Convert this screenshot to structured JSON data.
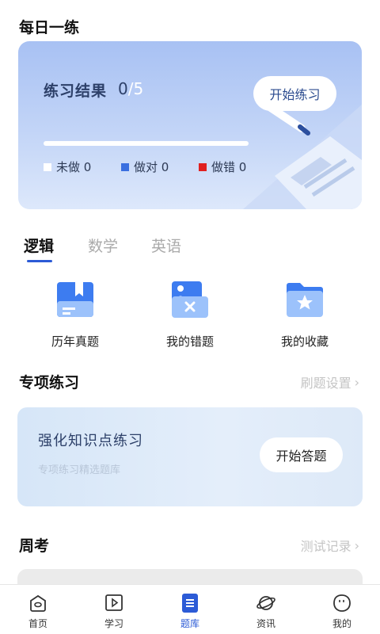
{
  "daily": {
    "title": "每日一练",
    "result_label": "练习结果",
    "done_count": "0",
    "separator": "/",
    "total_count": "5",
    "progress_fraction": 0,
    "start_label": "开始练习",
    "legend": [
      {
        "label": "未做",
        "count": "0",
        "color": "#ffffff"
      },
      {
        "label": "做对",
        "count": "0",
        "color": "#3a6fe0"
      },
      {
        "label": "做错",
        "count": "0",
        "color": "#e02020"
      }
    ]
  },
  "tabs": [
    {
      "label": "逻辑",
      "active": true
    },
    {
      "label": "数学",
      "active": false
    },
    {
      "label": "英语",
      "active": false
    }
  ],
  "features": [
    {
      "label": "历年真题",
      "icon": "book-icon"
    },
    {
      "label": "我的错题",
      "icon": "wrong-question-icon"
    },
    {
      "label": "我的收藏",
      "icon": "star-folder-icon"
    }
  ],
  "special": {
    "title": "专项练习",
    "settings_label": "刷题设置",
    "card_title": "强化知识点练习",
    "card_subtitle": "专项练习精选题库",
    "answer_label": "开始答题"
  },
  "weekly": {
    "title": "周考",
    "records_label": "测试记录"
  },
  "nav": [
    {
      "label": "首页",
      "icon": "home-icon",
      "active": false
    },
    {
      "label": "学习",
      "icon": "play-icon",
      "active": false
    },
    {
      "label": "题库",
      "icon": "question-bank-icon",
      "active": true
    },
    {
      "label": "资讯",
      "icon": "planet-icon",
      "active": false
    },
    {
      "label": "我的",
      "icon": "profile-icon",
      "active": false
    }
  ],
  "colors": {
    "accent": "#2c5bd6",
    "card_text": "#2d4069",
    "muted": "#c4c4c4"
  }
}
